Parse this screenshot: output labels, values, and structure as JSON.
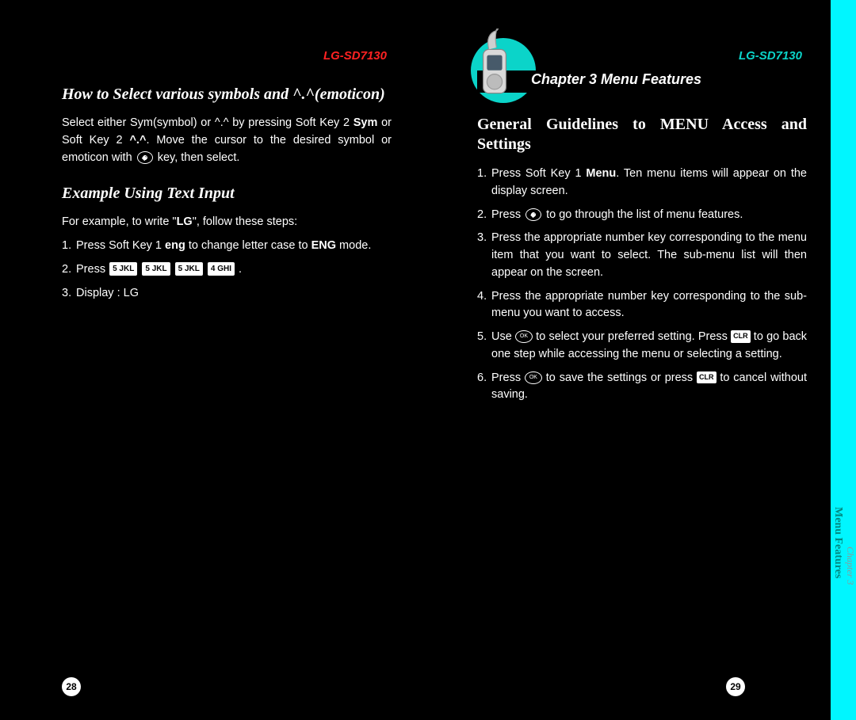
{
  "device_model": "LG-SD7130",
  "left": {
    "heading1": "How to Select various symbols and ^.^(emoticon)",
    "para1a": "Select either Sym(symbol) or ^.^ by pressing Soft Key 2 ",
    "para1b": "Sym",
    "para1c": " or Soft Key 2 ",
    "para1d": "^.^",
    "para1e": ". Move the cursor to the desired symbol or emoticon with ",
    "para1f": " key, then select.",
    "heading2": "Example Using Text Input",
    "ex_intro_a": "For example, to write \"",
    "ex_intro_b": "LG",
    "ex_intro_c": "\", follow these steps:",
    "step1_a": "Press Soft Key 1 ",
    "step1_b": "eng",
    "step1_c": " to change letter case to ",
    "step1_d": "ENG",
    "step1_e": " mode.",
    "step2": "Press ",
    "key5": "5 JKL",
    "key4": "4 GHI",
    "step2_end": " .",
    "step3": "Display : LG",
    "page_num": "28"
  },
  "right": {
    "chapter_banner": "Chapter 3 Menu Features",
    "heading": "General Guidelines to MENU Access and Settings",
    "s1a": "Press Soft Key 1 ",
    "s1b": "Menu",
    "s1c": ". Ten menu items will appear on the display screen.",
    "s2a": "Press ",
    "s2b": " to go through the list of menu features.",
    "s3": "Press the appropriate number key corresponding to the menu item that you want to select. The sub-menu list will then appear on the screen.",
    "s4": "Press the appropriate number key corresponding to the sub-menu you want to access.",
    "s5a": "Use ",
    "s5b": " to select your preferred setting. Press ",
    "s5c": " to go back one step while accessing the menu or selecting a setting.",
    "s6a": "Press ",
    "s6b": " to save the settings or press ",
    "s6c": " to cancel without saving.",
    "ok_label": "OK",
    "clr_label": "CLR",
    "page_num": "29"
  },
  "tab": {
    "chapter": "Chapter 3",
    "title": "Menu Features"
  }
}
